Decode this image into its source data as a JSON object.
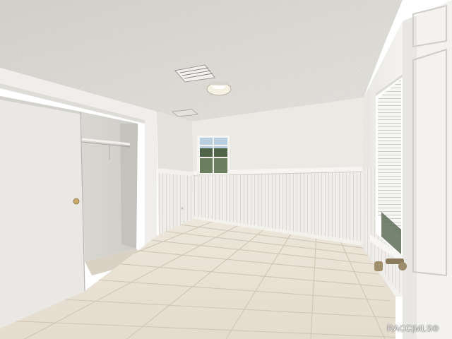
{
  "watermark": {
    "text": "RACC|MLS®"
  }
}
